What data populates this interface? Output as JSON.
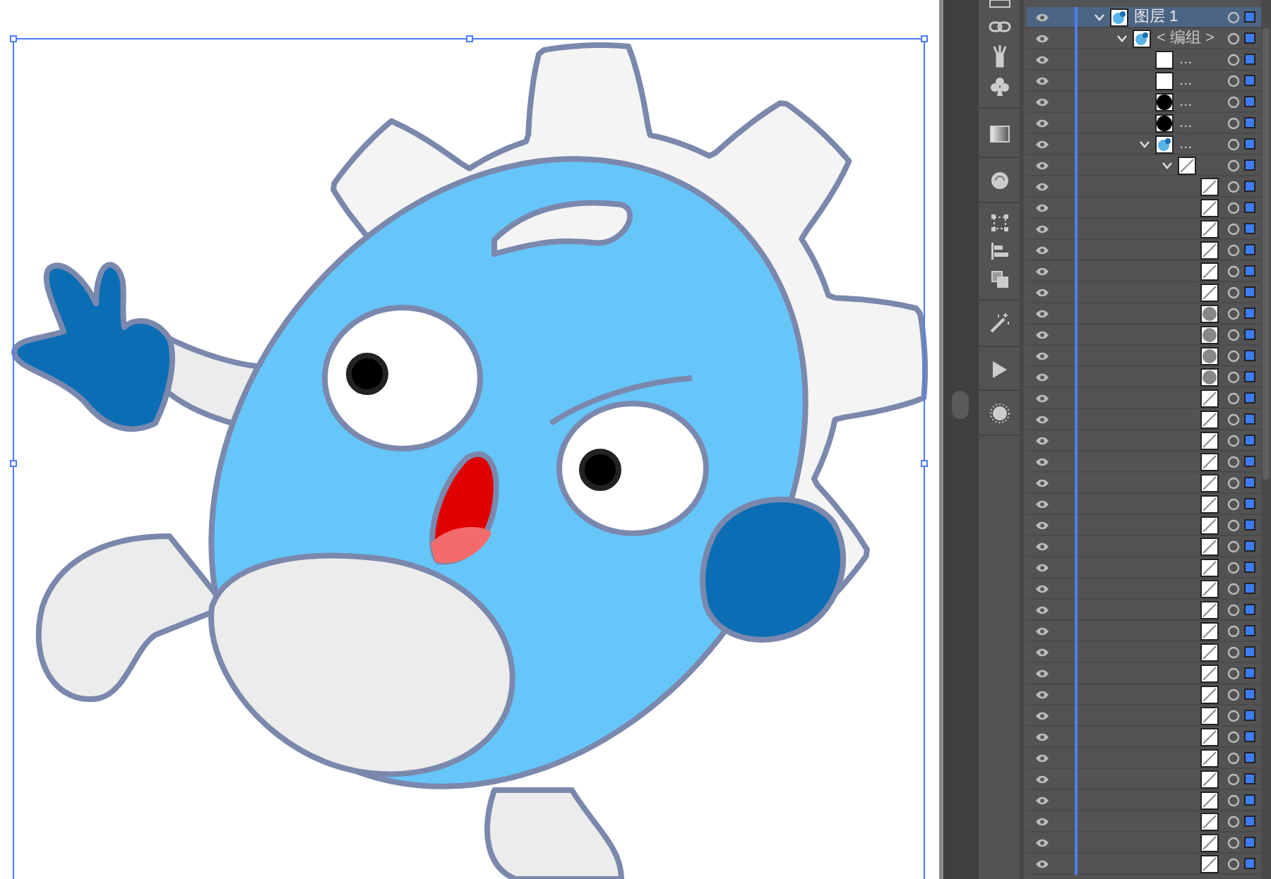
{
  "layers_panel": {
    "rows": [
      {
        "kind": "layer",
        "label": "图层 1",
        "visible": true,
        "selected": true,
        "expanded": true,
        "thumbnail": {
          "kind": "art"
        },
        "children": [
          {
            "kind": "group",
            "label": "< 编组 >",
            "visible": true,
            "selected": false,
            "expanded": true,
            "thumbnail": {
              "kind": "art"
            },
            "children": [
              {
                "kind": "path",
                "label": "...",
                "visible": true,
                "selected": false,
                "thumbnail": {
                  "kind": "white"
                }
              },
              {
                "kind": "path",
                "label": "...",
                "visible": true,
                "selected": false,
                "thumbnail": {
                  "kind": "white"
                }
              },
              {
                "kind": "path",
                "label": "...",
                "visible": true,
                "selected": false,
                "thumbnail": {
                  "kind": "black"
                }
              },
              {
                "kind": "path",
                "label": "...",
                "visible": true,
                "selected": false,
                "thumbnail": {
                  "kind": "black"
                }
              },
              {
                "kind": "group",
                "label": "...",
                "visible": true,
                "selected": false,
                "expanded": true,
                "thumbnail": {
                  "kind": "art"
                },
                "children": [
                  {
                    "kind": "group",
                    "visible": true,
                    "selected": false,
                    "expanded": true,
                    "thumbnail": {
                      "kind": "line"
                    },
                    "children": [
                      {
                        "kind": "path",
                        "visible": true,
                        "selected": false,
                        "thumbnail": {
                          "kind": "line"
                        }
                      },
                      {
                        "kind": "path",
                        "visible": true,
                        "selected": false,
                        "thumbnail": {
                          "kind": "line"
                        }
                      },
                      {
                        "kind": "path",
                        "visible": true,
                        "selected": false,
                        "thumbnail": {
                          "kind": "line"
                        }
                      },
                      {
                        "kind": "path",
                        "visible": true,
                        "selected": false,
                        "thumbnail": {
                          "kind": "line"
                        }
                      },
                      {
                        "kind": "path",
                        "visible": true,
                        "selected": false,
                        "thumbnail": {
                          "kind": "line"
                        }
                      },
                      {
                        "kind": "path",
                        "visible": true,
                        "selected": false,
                        "thumbnail": {
                          "kind": "line"
                        }
                      },
                      {
                        "kind": "path",
                        "visible": true,
                        "selected": false,
                        "thumbnail": {
                          "kind": "gray"
                        }
                      },
                      {
                        "kind": "path",
                        "visible": true,
                        "selected": false,
                        "thumbnail": {
                          "kind": "gray"
                        }
                      },
                      {
                        "kind": "path",
                        "visible": true,
                        "selected": false,
                        "thumbnail": {
                          "kind": "gray"
                        }
                      },
                      {
                        "kind": "path",
                        "visible": true,
                        "selected": false,
                        "thumbnail": {
                          "kind": "gray"
                        }
                      },
                      {
                        "kind": "path",
                        "visible": true,
                        "selected": false,
                        "thumbnail": {
                          "kind": "line"
                        }
                      },
                      {
                        "kind": "path",
                        "visible": true,
                        "selected": false,
                        "thumbnail": {
                          "kind": "line"
                        }
                      },
                      {
                        "kind": "path",
                        "visible": true,
                        "selected": false,
                        "thumbnail": {
                          "kind": "line"
                        }
                      },
                      {
                        "kind": "path",
                        "visible": true,
                        "selected": false,
                        "thumbnail": {
                          "kind": "line"
                        }
                      },
                      {
                        "kind": "path",
                        "visible": true,
                        "selected": false,
                        "thumbnail": {
                          "kind": "line"
                        }
                      },
                      {
                        "kind": "path",
                        "visible": true,
                        "selected": false,
                        "thumbnail": {
                          "kind": "line"
                        }
                      },
                      {
                        "kind": "path",
                        "visible": true,
                        "selected": false,
                        "thumbnail": {
                          "kind": "line"
                        }
                      },
                      {
                        "kind": "path",
                        "visible": true,
                        "selected": false,
                        "thumbnail": {
                          "kind": "line"
                        }
                      },
                      {
                        "kind": "path",
                        "visible": true,
                        "selected": false,
                        "thumbnail": {
                          "kind": "line"
                        }
                      },
                      {
                        "kind": "path",
                        "visible": true,
                        "selected": false,
                        "thumbnail": {
                          "kind": "line"
                        }
                      },
                      {
                        "kind": "path",
                        "visible": true,
                        "selected": false,
                        "thumbnail": {
                          "kind": "line"
                        }
                      },
                      {
                        "kind": "path",
                        "visible": true,
                        "selected": false,
                        "thumbnail": {
                          "kind": "line"
                        }
                      },
                      {
                        "kind": "path",
                        "visible": true,
                        "selected": false,
                        "thumbnail": {
                          "kind": "line"
                        }
                      },
                      {
                        "kind": "path",
                        "visible": true,
                        "selected": false,
                        "thumbnail": {
                          "kind": "line"
                        }
                      },
                      {
                        "kind": "path",
                        "visible": true,
                        "selected": false,
                        "thumbnail": {
                          "kind": "line"
                        }
                      },
                      {
                        "kind": "path",
                        "visible": true,
                        "selected": false,
                        "thumbnail": {
                          "kind": "line"
                        }
                      },
                      {
                        "kind": "path",
                        "visible": true,
                        "selected": false,
                        "thumbnail": {
                          "kind": "line"
                        }
                      },
                      {
                        "kind": "path",
                        "visible": true,
                        "selected": false,
                        "thumbnail": {
                          "kind": "line"
                        }
                      },
                      {
                        "kind": "path",
                        "visible": true,
                        "selected": false,
                        "thumbnail": {
                          "kind": "line"
                        }
                      },
                      {
                        "kind": "path",
                        "visible": true,
                        "selected": false,
                        "thumbnail": {
                          "kind": "line"
                        }
                      },
                      {
                        "kind": "path",
                        "visible": true,
                        "selected": false,
                        "thumbnail": {
                          "kind": "line"
                        }
                      },
                      {
                        "kind": "path",
                        "visible": true,
                        "selected": false,
                        "thumbnail": {
                          "kind": "line"
                        }
                      },
                      {
                        "kind": "path",
                        "visible": true,
                        "selected": false,
                        "thumbnail": {
                          "kind": "line"
                        }
                      }
                    ]
                  }
                ]
              }
            ]
          }
        ]
      }
    ]
  }
}
